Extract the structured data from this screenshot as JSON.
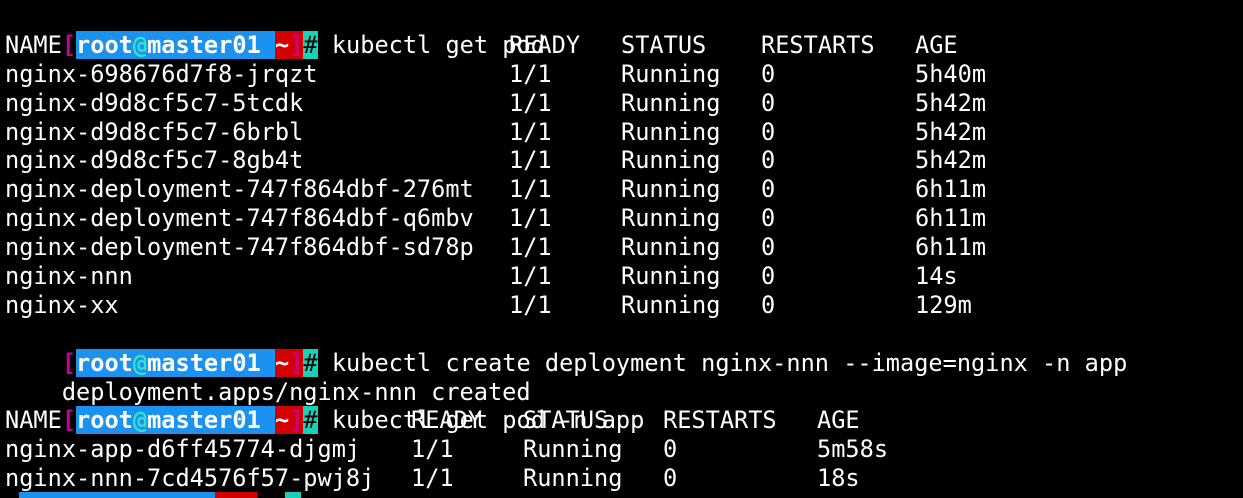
{
  "prompt": {
    "open_bracket": "[",
    "user": "root",
    "at": "@",
    "host": "master01",
    "path": "~",
    "close_bracket": "]",
    "symbol": "#",
    "colors": {
      "user_bg": "#1c92f0",
      "path_bg": "#d40000",
      "hash_bg": "#17d2b8",
      "bracket": "#c8008c",
      "at": "#34e0c8"
    }
  },
  "commands": {
    "cmd1": "kubectl get pod",
    "cmd2": "kubectl create deployment nginx-nnn --image=nginx -n app",
    "cmd3": "kubectl get pod -n app"
  },
  "output": {
    "create_result": "deployment.apps/nginx-nnn created"
  },
  "table1": {
    "headers": [
      "NAME",
      "READY",
      "STATUS",
      "RESTARTS",
      "AGE"
    ],
    "rows": [
      [
        "nginx-698676d7f8-jrqzt",
        "1/1",
        "Running",
        "0",
        "5h40m"
      ],
      [
        "nginx-d9d8cf5c7-5tcdk",
        "1/1",
        "Running",
        "0",
        "5h42m"
      ],
      [
        "nginx-d9d8cf5c7-6brbl",
        "1/1",
        "Running",
        "0",
        "5h42m"
      ],
      [
        "nginx-d9d8cf5c7-8gb4t",
        "1/1",
        "Running",
        "0",
        "5h42m"
      ],
      [
        "nginx-deployment-747f864dbf-276mt",
        "1/1",
        "Running",
        "0",
        "6h11m"
      ],
      [
        "nginx-deployment-747f864dbf-q6mbv",
        "1/1",
        "Running",
        "0",
        "6h11m"
      ],
      [
        "nginx-deployment-747f864dbf-sd78p",
        "1/1",
        "Running",
        "0",
        "6h11m"
      ],
      [
        "nginx-nnn",
        "1/1",
        "Running",
        "0",
        "14s"
      ],
      [
        "nginx-xx",
        "1/1",
        "Running",
        "0",
        "129m"
      ]
    ]
  },
  "table2": {
    "headers": [
      "NAME",
      "READY",
      "STATUS",
      "RESTARTS",
      "AGE"
    ],
    "rows": [
      [
        "nginx-app-d6ff45774-djgmj",
        "1/1",
        "Running",
        "0",
        "5m58s"
      ],
      [
        "nginx-nnn-7cd4576f57-pwj8j",
        "1/1",
        "Running",
        "0",
        "18s"
      ]
    ]
  }
}
